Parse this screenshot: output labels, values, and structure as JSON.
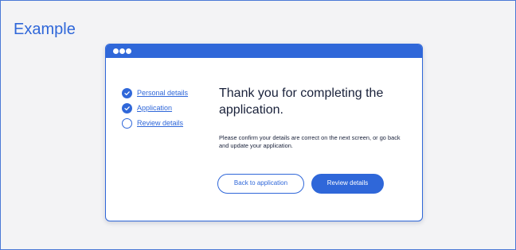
{
  "example": {
    "title": "Example",
    "window": {
      "steps": [
        {
          "label": "Personal details",
          "status": "complete",
          "icon": "check-circle-icon"
        },
        {
          "label": "Application",
          "status": "complete",
          "icon": "check-circle-icon"
        },
        {
          "label": "Review details",
          "status": "pending",
          "icon": "empty-circle-icon"
        }
      ],
      "headline": "Thank you for completing the application.",
      "description": "Please confirm your details are correct on the next screen, or go back and update your application.",
      "buttons": {
        "back": "Back to application",
        "review": "Review details"
      }
    }
  },
  "colors": {
    "accent": "#2f67d9",
    "panel_background": "#f3f3f5",
    "text": "#19213a"
  }
}
